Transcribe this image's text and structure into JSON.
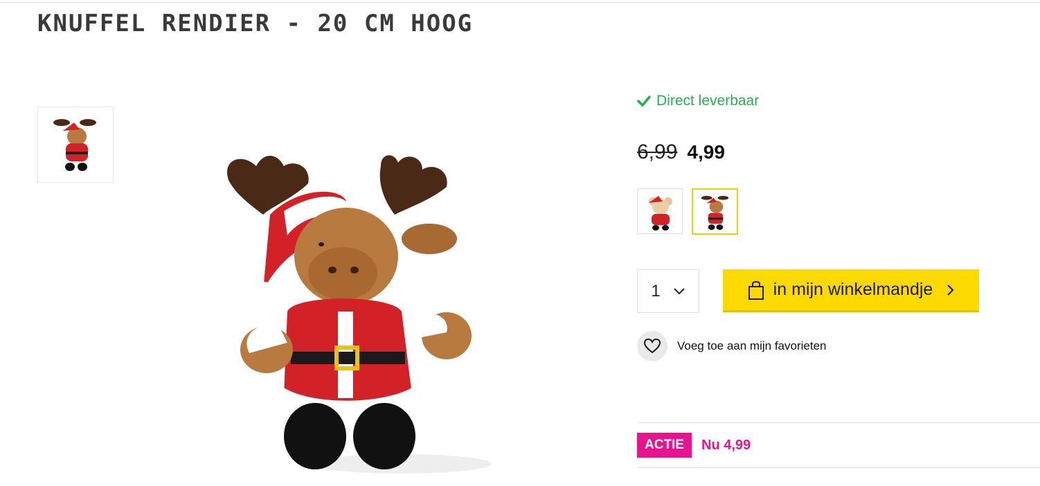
{
  "product": {
    "title": "Knuffel Rendier - 20 cm hoog",
    "availability": "Direct leverbaar",
    "old_price": "6,99",
    "new_price": "4,99"
  },
  "purchase": {
    "quantity": "1",
    "add_to_cart_label": "in mijn winkelmandje",
    "favorite_label": "Voeg toe aan mijn favorieten"
  },
  "promo": {
    "badge": "ACTIE",
    "text": "Nu 4,99"
  },
  "colors": {
    "accent_yellow": "#fcd900",
    "stock_green": "#23b14d",
    "promo_pink": "#e6158f"
  },
  "icons": [
    "check-icon",
    "shopping-bag-icon",
    "chevron-down-icon",
    "chevron-right-icon",
    "heart-icon"
  ]
}
